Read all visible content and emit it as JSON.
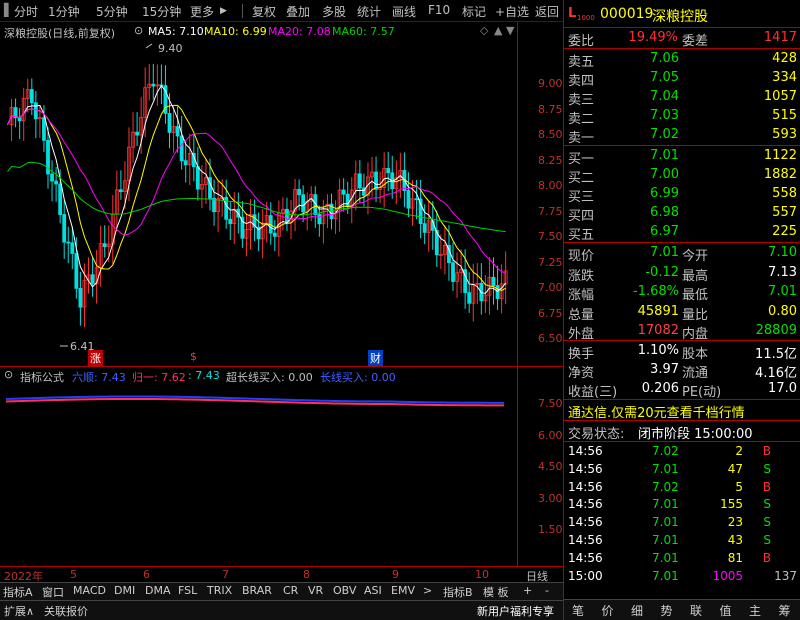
{
  "toolbar": {
    "left_items": [
      "分时",
      "1分钟",
      "5分钟",
      "15分钟",
      "更多"
    ],
    "right_items": [
      "复权",
      "叠加",
      "多股",
      "统计",
      "画线",
      "F10",
      "标记",
      "+自选",
      "返回"
    ]
  },
  "chart": {
    "stock_title": "深粮控股(日线,前复权)",
    "ma5_label": "MA5: 7.10",
    "ma10_label": "MA10: 6.99",
    "ma20_label": "MA20: 7.08",
    "ma60_label": "MA60: 7.57",
    "high_mark": "9.40",
    "low_mark": "6.41",
    "event_labels": [
      "涨",
      "$",
      "财"
    ],
    "price_ticks": [
      "9.00",
      "8.75",
      "8.50",
      "8.25",
      "8.00",
      "7.75",
      "7.50",
      "7.25",
      "7.00",
      "6.75",
      "6.50"
    ],
    "indicator_title": "指标公式",
    "ind_items": [
      "六顺: 7.43",
      "归一: 7.62",
      ": 7.43",
      "超长线买入: 0.00",
      "长线买入: 0.00"
    ],
    "ind_ticks": [
      "7.50",
      "6.00",
      "4.50",
      "3.00",
      "1.50"
    ],
    "date_labels": [
      "2022年",
      "5",
      "6",
      "7",
      "8",
      "9",
      "10"
    ],
    "date_right": "日线",
    "colors": {
      "up": "#ff3232",
      "down": "#00e0e0",
      "ma5": "#ffffff",
      "ma10": "#ffff00",
      "ma20": "#ff00ff",
      "ma60": "#00d000"
    }
  },
  "tabs": [
    "指标A",
    "窗口",
    "MACD",
    "DMI",
    "DMA",
    "FSL",
    "TRIX",
    "BRAR",
    "CR",
    "VR",
    "OBV",
    "ASI",
    "EMV",
    ">",
    "指标B",
    "模 板",
    "+",
    "-"
  ],
  "bottom": {
    "left1": "扩展∧",
    "left2": "关联报价",
    "right": "新用户福利专享"
  },
  "panel": {
    "code": "000019",
    "name": "深粮控股",
    "weibi_label": "委比",
    "weibi_val": "19.49%",
    "weicha_label": "委差",
    "weicha_val": "1417",
    "asks": [
      {
        "label": "卖五",
        "price": "7.06",
        "vol": "428"
      },
      {
        "label": "卖四",
        "price": "7.05",
        "vol": "334"
      },
      {
        "label": "卖三",
        "price": "7.04",
        "vol": "1057"
      },
      {
        "label": "卖二",
        "price": "7.03",
        "vol": "515"
      },
      {
        "label": "卖一",
        "price": "7.02",
        "vol": "593"
      }
    ],
    "bids": [
      {
        "label": "买一",
        "price": "7.01",
        "vol": "1122"
      },
      {
        "label": "买二",
        "price": "7.00",
        "vol": "1882"
      },
      {
        "label": "买三",
        "price": "6.99",
        "vol": "558"
      },
      {
        "label": "买四",
        "price": "6.98",
        "vol": "557"
      },
      {
        "label": "买五",
        "price": "6.97",
        "vol": "225"
      }
    ],
    "stats": [
      {
        "l1": "现价",
        "v1": "7.01",
        "c1": "#00e000",
        "l2": "今开",
        "v2": "7.10",
        "c2": "#00e000"
      },
      {
        "l1": "涨跌",
        "v1": "-0.12",
        "c1": "#00e000",
        "l2": "最高",
        "v2": "7.13",
        "c2": "#ffffff"
      },
      {
        "l1": "涨幅",
        "v1": "-1.68%",
        "c1": "#00e000",
        "l2": "最低",
        "v2": "7.01",
        "c2": "#00e000"
      },
      {
        "l1": "总量",
        "v1": "45891",
        "c1": "#ffff00",
        "l2": "量比",
        "v2": "0.80",
        "c2": "#ffff00"
      },
      {
        "l1": "外盘",
        "v1": "17082",
        "c1": "#ff4040",
        "l2": "内盘",
        "v2": "28809",
        "c2": "#00e000"
      }
    ],
    "stats2": [
      {
        "l1": "换手",
        "v1": "1.10%",
        "l2": "股本",
        "v2": "11.5亿"
      },
      {
        "l1": "净资",
        "v1": "3.97",
        "l2": "流通",
        "v2": "4.16亿"
      },
      {
        "l1": "收益(三)",
        "v1": "0.206",
        "l2": "PE(动)",
        "v2": "17.0"
      }
    ],
    "ad": "通达信.仅需20元查看千档行情",
    "status_label": "交易状态:",
    "status_val": "闭市阶段 15:00:00",
    "ticks": [
      {
        "t": "14:56",
        "p": "7.02",
        "v": "2",
        "d": "B"
      },
      {
        "t": "14:56",
        "p": "7.01",
        "v": "47",
        "d": "S"
      },
      {
        "t": "14:56",
        "p": "7.02",
        "v": "5",
        "d": "B"
      },
      {
        "t": "14:56",
        "p": "7.01",
        "v": "155",
        "d": "S"
      },
      {
        "t": "14:56",
        "p": "7.01",
        "v": "23",
        "d": "S"
      },
      {
        "t": "14:56",
        "p": "7.01",
        "v": "43",
        "d": "S"
      },
      {
        "t": "14:56",
        "p": "7.01",
        "v": "81",
        "d": "B"
      },
      {
        "t": "15:00",
        "p": "7.01",
        "v": "1005",
        "d": "137"
      }
    ],
    "bottom_tabs": [
      "笔",
      "价",
      "细",
      "势",
      "联",
      "值",
      "主",
      "筹"
    ]
  }
}
